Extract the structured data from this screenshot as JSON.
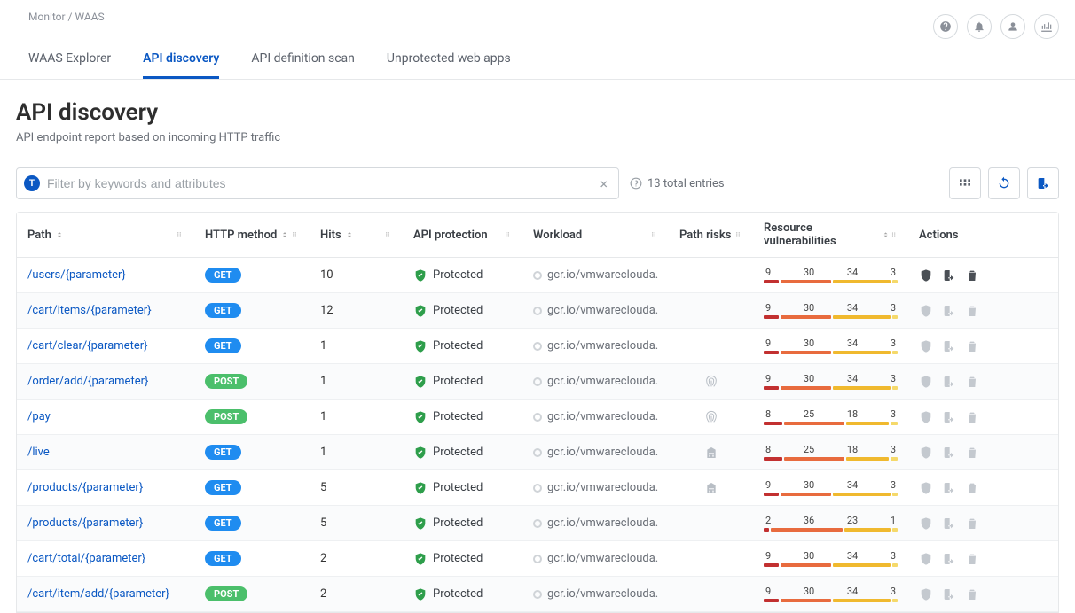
{
  "breadcrumb": "Monitor / WAAS",
  "tabs": [
    "WAAS Explorer",
    "API discovery",
    "API definition scan",
    "Unprotected web apps"
  ],
  "active_tab": 1,
  "title": "API discovery",
  "subtitle": "API endpoint report based on incoming HTTP traffic",
  "filter": {
    "chip": "T",
    "placeholder": "Filter by keywords and attributes"
  },
  "entries_text": "13 total entries",
  "columns": [
    "Path",
    "HTTP method",
    "Hits",
    "API protection",
    "Workload",
    "Path risks",
    "Resource vulnerabilities",
    "Actions"
  ],
  "protection_label": "Protected",
  "workload_text": "gcr.io/vmwareclouda...",
  "rows": [
    {
      "path": "/users/{parameter}",
      "method": "GET",
      "hits": "10",
      "risk": "",
      "vuln": [
        9,
        30,
        34,
        3
      ],
      "actions_dark": true
    },
    {
      "path": "/cart/items/{parameter}",
      "method": "GET",
      "hits": "12",
      "risk": "",
      "vuln": [
        9,
        30,
        34,
        3
      ],
      "actions_dark": false
    },
    {
      "path": "/cart/clear/{parameter}",
      "method": "GET",
      "hits": "1",
      "risk": "",
      "vuln": [
        9,
        30,
        34,
        3
      ],
      "actions_dark": false
    },
    {
      "path": "/order/add/{parameter}",
      "method": "POST",
      "hits": "1",
      "risk": "fingerprint",
      "vuln": [
        9,
        30,
        34,
        3
      ],
      "actions_dark": false
    },
    {
      "path": "/pay",
      "method": "POST",
      "hits": "1",
      "risk": "fingerprint",
      "vuln": [
        8,
        25,
        18,
        3
      ],
      "actions_dark": false
    },
    {
      "path": "/live",
      "method": "GET",
      "hits": "1",
      "risk": "building",
      "vuln": [
        8,
        25,
        18,
        3
      ],
      "actions_dark": false
    },
    {
      "path": "/products/{parameter}",
      "method": "GET",
      "hits": "5",
      "risk": "building",
      "vuln": [
        9,
        30,
        34,
        3
      ],
      "actions_dark": false
    },
    {
      "path": "/products/{parameter}",
      "method": "GET",
      "hits": "5",
      "risk": "",
      "vuln": [
        2,
        36,
        23,
        1
      ],
      "actions_dark": false
    },
    {
      "path": "/cart/total/{parameter}",
      "method": "GET",
      "hits": "2",
      "risk": "",
      "vuln": [
        9,
        30,
        34,
        3
      ],
      "actions_dark": false
    },
    {
      "path": "/cart/item/add/{parameter}",
      "method": "POST",
      "hits": "2",
      "risk": "",
      "vuln": [
        9,
        30,
        34,
        3
      ],
      "actions_dark": false
    }
  ]
}
